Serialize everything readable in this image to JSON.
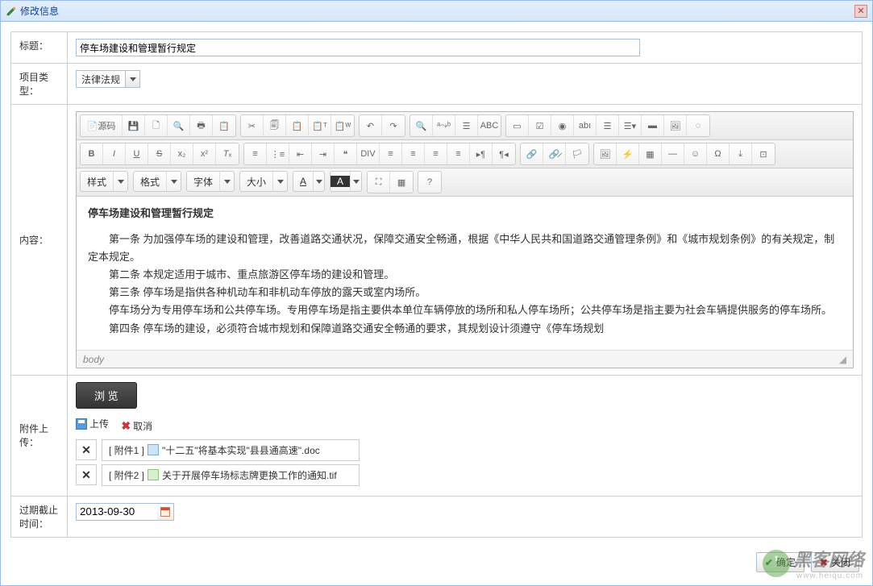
{
  "dialog": {
    "title": "修改信息"
  },
  "fields": {
    "title_label": "标题：",
    "title_value": "停车场建设和管理暂行规定",
    "type_label": "项目类型：",
    "type_value": "法律法规",
    "content_label": "内容：",
    "attach_label": "附件上传：",
    "expire_label": "过期截止时间：",
    "expire_value": "2013-09-30"
  },
  "editor": {
    "source_label": "源码",
    "style_label": "样式",
    "format_label": "格式",
    "font_label": "字体",
    "size_label": "大小",
    "path": "body",
    "doc_title": "停车场建设和管理暂行规定",
    "para1": "第一条  为加强停车场的建设和管理，改善道路交通状况，保障交通安全畅通，根据《中华人民共和国道路交通管理条例》和《城市规划条例》的有关规定，制定本规定。",
    "para2": "第二条  本规定适用于城市、重点旅游区停车场的建设和管理。",
    "para3": "第三条  停车场是指供各种机动车和非机动车停放的露天或室内场所。",
    "para4": "停车场分为专用停车场和公共停车场。专用停车场是指主要供本单位车辆停放的场所和私人停车场所；公共停车场是指主要为社会车辆提供服务的停车场所。",
    "para5": "第四条  停车场的建设，必须符合城市规划和保障道路交通安全畅通的要求，其规划设计须遵守《停车场规划"
  },
  "attach": {
    "browse": "浏 览",
    "upload": "上传",
    "cancel": "取消",
    "items": [
      {
        "prefix": "[ 附件1 ]",
        "name": "\"十二五\"将基本实现\"县县通高速\".doc",
        "type": "doc"
      },
      {
        "prefix": "[ 附件2 ]",
        "name": "关于开展停车场标志牌更换工作的通知.tif",
        "type": "img"
      }
    ]
  },
  "buttons": {
    "ok": "确定",
    "close": "关闭"
  },
  "watermark": {
    "brand": "黑客网络",
    "url": "www.heiqu.com"
  }
}
